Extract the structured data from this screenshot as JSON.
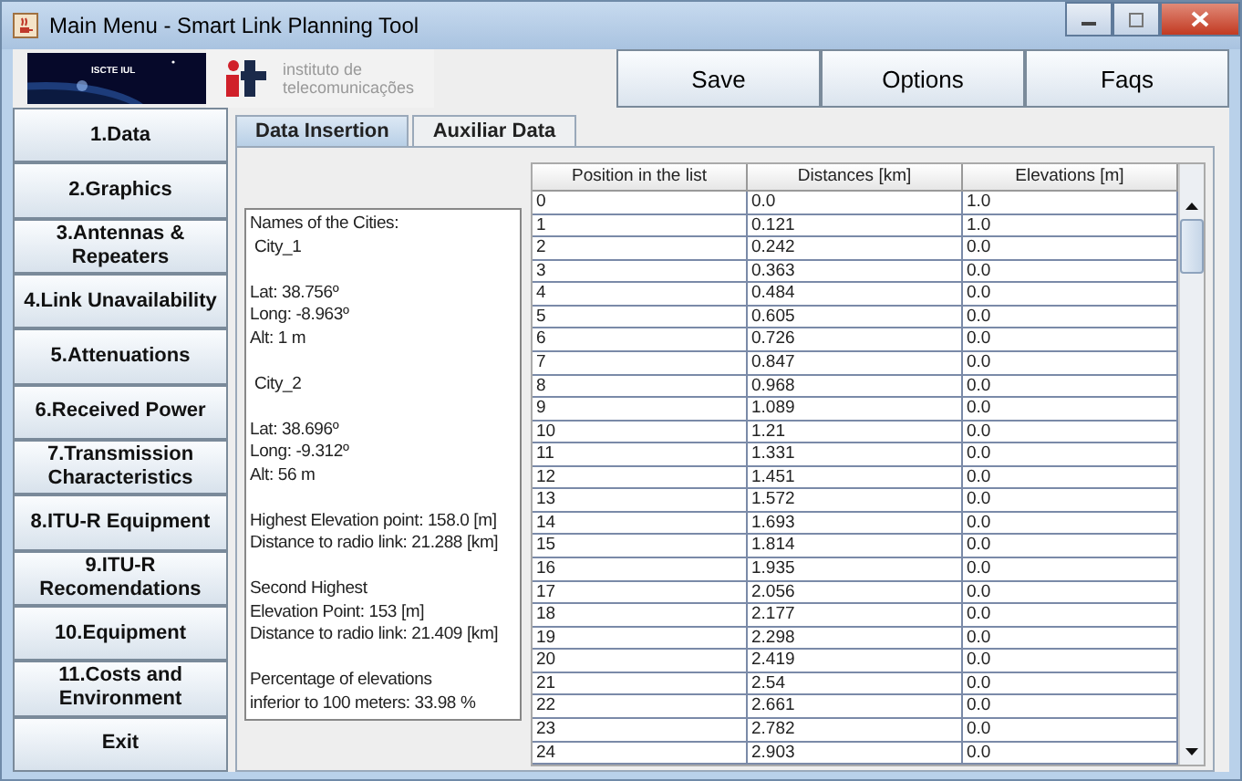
{
  "window": {
    "title": "Main Menu - Smart Link Planning Tool"
  },
  "header": {
    "logo_text": "ISCTE IUL",
    "it_logo": [
      "instituto de",
      "telecomunicações"
    ],
    "buttons": [
      "Save",
      "Options",
      "Faqs"
    ]
  },
  "sidebar": {
    "items": [
      "1.Data",
      "2.Graphics",
      "3.Antennas & Repeaters",
      "4.Link Unavailability",
      "5.Attenuations",
      "6.Received Power",
      "7.Transmission Characteristics",
      "8.ITU-R Equipment",
      "9.ITU-R Recomendations",
      "10.Equipment",
      "11.Costs and Environment",
      "Exit"
    ]
  },
  "tabs": [
    {
      "label": "Data Insertion",
      "selected": true
    },
    {
      "label": "Auxiliar Data",
      "selected": false
    }
  ],
  "info_blocks": [
    [
      "Names of the Cities:",
      " City_1"
    ],
    [
      "Lat: 38.756º",
      "Long: -8.963º",
      "Alt: 1 m"
    ],
    [
      " City_2"
    ],
    [
      "Lat: 38.696º",
      "Long: -9.312º",
      "Alt: 56 m"
    ],
    [
      "Highest Elevation point: 158.0 [m]",
      "Distance to radio link: 21.288 [km]"
    ],
    [
      "Second Highest",
      "Elevation Point: 153 [m]",
      "Distance to radio link: 21.409 [km]"
    ],
    [
      "Percentage of elevations",
      "inferior to 100 meters: 33.98 %"
    ]
  ],
  "table": {
    "columns": [
      "Position in the list",
      "Distances [km]",
      "Elevations [m]"
    ],
    "rows": [
      [
        "0",
        "0.0",
        "1.0"
      ],
      [
        "1",
        "0.121",
        "1.0"
      ],
      [
        "2",
        "0.242",
        "0.0"
      ],
      [
        "3",
        "0.363",
        "0.0"
      ],
      [
        "4",
        "0.484",
        "0.0"
      ],
      [
        "5",
        "0.605",
        "0.0"
      ],
      [
        "6",
        "0.726",
        "0.0"
      ],
      [
        "7",
        "0.847",
        "0.0"
      ],
      [
        "8",
        "0.968",
        "0.0"
      ],
      [
        "9",
        "1.089",
        "0.0"
      ],
      [
        "10",
        "1.21",
        "0.0"
      ],
      [
        "11",
        "1.331",
        "0.0"
      ],
      [
        "12",
        "1.451",
        "0.0"
      ],
      [
        "13",
        "1.572",
        "0.0"
      ],
      [
        "14",
        "1.693",
        "0.0"
      ],
      [
        "15",
        "1.814",
        "0.0"
      ],
      [
        "16",
        "1.935",
        "0.0"
      ],
      [
        "17",
        "2.056",
        "0.0"
      ],
      [
        "18",
        "2.177",
        "0.0"
      ],
      [
        "19",
        "2.298",
        "0.0"
      ],
      [
        "20",
        "2.419",
        "0.0"
      ],
      [
        "21",
        "2.54",
        "0.0"
      ],
      [
        "22",
        "2.661",
        "0.0"
      ],
      [
        "23",
        "2.782",
        "0.0"
      ],
      [
        "24",
        "2.903",
        "0.0"
      ]
    ]
  }
}
